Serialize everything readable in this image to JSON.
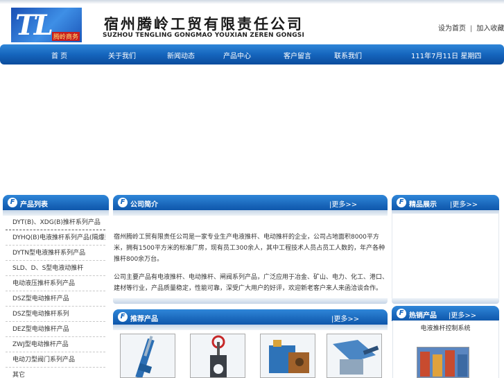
{
  "logo": {
    "mark": "TL",
    "tag": "腾岭商务"
  },
  "company": {
    "name_cn": "宿州腾岭工贸有限责任公司",
    "name_en": "SUZHOU TENGLING GONGMAO YOUXIAN ZEREN GONGSI"
  },
  "toplinks": [
    "设为首页",
    "加入收藏"
  ],
  "nav": {
    "items": [
      "首 页",
      "关于我们",
      "新闻动态",
      "产品中心",
      "客户留言",
      "联系我们"
    ],
    "date": "111年7月11日 星期四"
  },
  "left": {
    "title": "产品列表",
    "items": [
      "DYT(B)、XDG(B)推杆系列产品",
      "DYHQ(B)电液推杆系列产品(隔爆型)",
      "DYTN型电液推杆系列产品",
      "SLD、D、S型电液动推杆",
      "电动液压推杆系列产品",
      "DSZ型电动推杆产品",
      "DSZ型电动推杆系列",
      "DEZ型电动推杆产品",
      "ZWJ型电动推杆产品",
      "电动刀型阀门系列产品",
      "其它"
    ]
  },
  "about": {
    "title": "公司简介",
    "more": "|更多>>",
    "paragraphs": [
      "宿州腾岭工贸有限责任公司是一家专业生产电液推杆、电动推杆的企业，公司占地面积8000平方米，拥有1500平方米的标准厂房，现有员工300余人，其中工程技术人员占员工人数的，年产各种推杆800余万台。",
      "公司主要产品有电液推杆、电动推杆、闸阀系列产品，广泛应用于冶金、矿山、电力、化工、港口、建材等行业，产品质量稳定，性能可靠，深受广大用户的好评，欢迎新老客户来人来函洽谈合作。"
    ]
  },
  "recommend": {
    "title": "推荐产品",
    "more": "|更多>>"
  },
  "showcase": {
    "title": "精品展示",
    "more": "|更多>>"
  },
  "hot": {
    "title": "热销产品",
    "more": "|更多>>",
    "item_label": "电液推杆控制系统"
  },
  "colors": {
    "nav_blue": "#1565bd",
    "header_blue": "#2f86d8"
  }
}
